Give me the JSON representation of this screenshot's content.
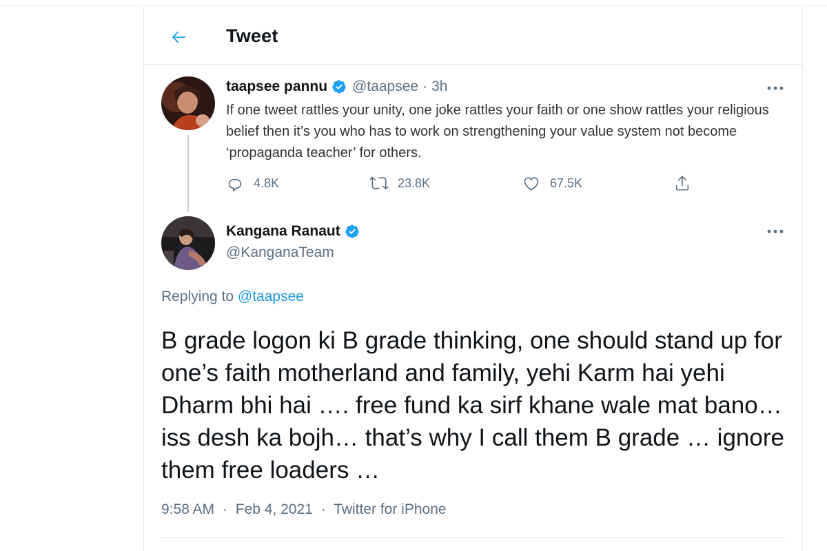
{
  "header": {
    "title": "Tweet"
  },
  "original_tweet": {
    "name": "taapsee pannu",
    "handle": "@taapsee",
    "separator": "·",
    "time": "3h",
    "text": "If one tweet rattles your unity, one joke rattles your faith or one show rattles your religious belief then it’s you who has to work on strengthening your value system not become ‘propaganda teacher’ for others.",
    "replies": "4.8K",
    "retweets": "23.8K",
    "likes": "67.5K"
  },
  "reply_tweet": {
    "name": "Kangana Ranaut",
    "handle": "@KanganaTeam",
    "replying_prefix": "Replying to",
    "replying_to": "@taapsee",
    "text": "B grade logon ki B grade thinking, one should stand up for one’s faith motherland and family, yehi Karm hai yehi Dharm bhi hai …. free fund ka sirf khane wale mat bano… iss desh ka bojh… that’s why I call them B grade … ignore them free loaders …",
    "time": "9:58 AM",
    "separator": "·",
    "date": "Feb 4, 2021",
    "source": "Twitter for iPhone"
  },
  "colors": {
    "accent": "#1da1f2",
    "link": "#1b95e0",
    "muted": "#5b7083",
    "border": "#e6ecf0"
  },
  "icons": [
    "back-arrow-icon",
    "verified-badge-icon",
    "more-icon",
    "reply-icon",
    "retweet-icon",
    "like-icon",
    "share-icon"
  ]
}
